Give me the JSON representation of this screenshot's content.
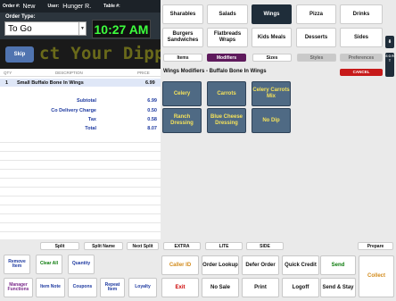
{
  "header": {
    "order_label": "Order #:",
    "order_value": "New",
    "user_label": "User:",
    "user_value": "Hunger R.",
    "table_label": "Table #:"
  },
  "order_type": {
    "label": "Order Type:",
    "value": "To Go"
  },
  "clock": "10:27 AM",
  "marquee": "ct Your Dipping Sauce",
  "skip": "Skip",
  "columns": {
    "qty": "QTY",
    "description": "DESCRIPTION",
    "price": "PRICE"
  },
  "order_items": [
    {
      "qty": "1",
      "description": "Small Buffalo Bone In Wings",
      "price": "6.99"
    }
  ],
  "totals": [
    {
      "label": "Subtotal",
      "value": "6.99"
    },
    {
      "label": "Co Delivery Charge",
      "value": "0.50"
    },
    {
      "label": "Tax",
      "value": "0.58"
    },
    {
      "label": "Total",
      "value": "8.07"
    }
  ],
  "split_row": [
    "Split",
    "Split Name",
    "Next Split"
  ],
  "action_buttons": {
    "remove_item": "Remove Item",
    "clear_all": "Clear All",
    "quantity": "Quantity",
    "manager_functions": "Manager Functions",
    "item_note": "Item Note",
    "coupons": "Coupons",
    "repeat_item": "Repeat Item",
    "loyalty": "Loyalty"
  },
  "categories": [
    [
      "Sharables",
      "Salads",
      "Wings",
      "Pizza",
      "Drinks"
    ],
    [
      "Burgers Sandwiches",
      "Flatbreads Wraps",
      "Kids Meals",
      "Desserts",
      "Sides"
    ]
  ],
  "selected_category": "Wings",
  "mod_tabs": [
    "Items",
    "Modifiers",
    "Sizes",
    "Styles",
    "Preferences"
  ],
  "panel_title": "Wings Modifiers - Buffalo Bone In Wings",
  "cancel": "CANCEL",
  "modifiers": [
    [
      "Celery",
      "Carrots",
      "Celery Carrots Mix"
    ],
    [
      "Ranch Dressing",
      "Blue Cheese Dressing",
      "No Dip"
    ]
  ],
  "side_label": "S O R T",
  "extras": [
    "EXTRA",
    "LITE",
    "SIDE"
  ],
  "prepare": "Prepare",
  "bottom_buttons": {
    "caller_id": "Caller ID",
    "order_lookup": "Order Lookup",
    "defer_order": "Defer Order",
    "quick_credit": "Quick Credit",
    "send": "Send",
    "collect": "Collect",
    "exit": "Exit",
    "no_sale": "No Sale",
    "print": "Print",
    "logoff": "Logoff",
    "send_stay": "Send & Stay"
  },
  "colors": {
    "header_bg": "#1c2228",
    "clock_green": "#3dff3d",
    "mod_bg": "#4f6a84",
    "mod_text": "#f5e25a",
    "selected_cat": "#1f2d3a",
    "modifiers_tab": "#5e1a5c",
    "cancel": "#c71a1a"
  }
}
